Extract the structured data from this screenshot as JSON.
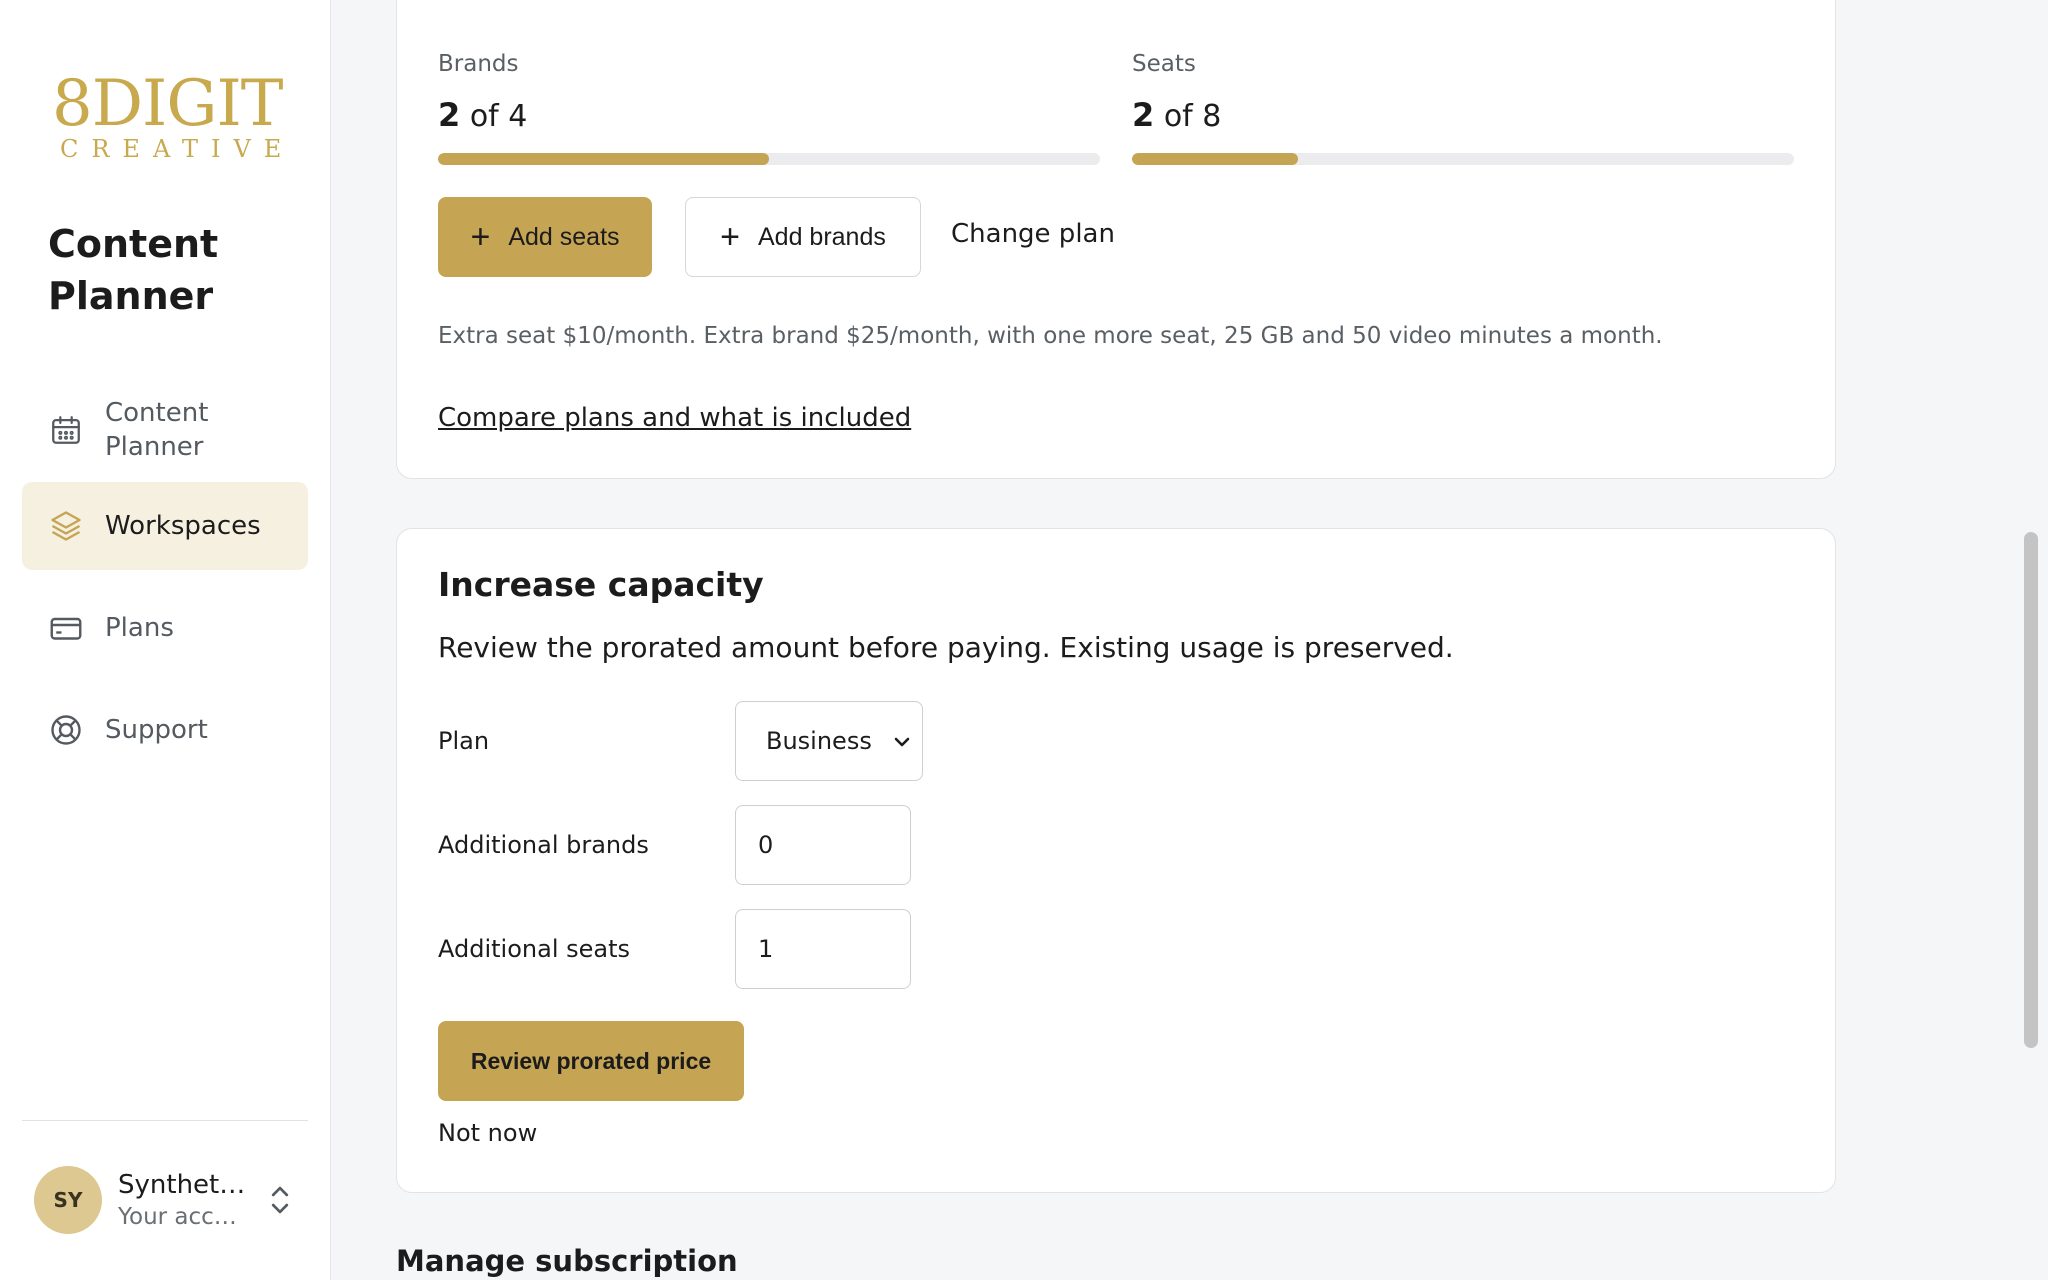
{
  "logo": {
    "line1": "8DIGIT",
    "line2": "CREATIVE"
  },
  "app_title": "Content Planner",
  "nav": [
    {
      "label": "Content Planner",
      "icon": "calendar-icon"
    },
    {
      "label": "Workspaces",
      "icon": "layers-icon",
      "active": true
    },
    {
      "label": "Plans",
      "icon": "credit-card-icon"
    },
    {
      "label": "Support",
      "icon": "lifebuoy-icon"
    }
  ],
  "account": {
    "initials": "SY",
    "name": "Syntheti...",
    "subtitle": "Your acco..."
  },
  "usage": {
    "brands": {
      "label": "Brands",
      "used": "2",
      "of_text": "of 4",
      "fraction": 0.5
    },
    "seats": {
      "label": "Seats",
      "used": "2",
      "of_text": "of 8",
      "fraction": 0.25
    }
  },
  "actions": {
    "add_seats": "Add seats",
    "add_brands": "Add brands",
    "change_plan": "Change plan"
  },
  "pricing_note": "Extra seat $10/month. Extra brand $25/month, with one more seat, 25 GB and 50 video minutes a month.",
  "compare_link": "Compare plans and what is included",
  "capacity": {
    "title": "Increase capacity",
    "description": "Review the prorated amount before paying. Existing usage is preserved.",
    "plan_label": "Plan",
    "plan_value": "Business",
    "brands_label": "Additional brands",
    "brands_value": "0",
    "seats_label": "Additional seats",
    "seats_value": "1",
    "review_button": "Review prorated price",
    "not_now": "Not now"
  },
  "manage_subscription": "Manage subscription",
  "colors": {
    "accent": "#c5a453",
    "active_nav_bg": "#f6f0e1",
    "avatar_bg": "#dcc890"
  }
}
